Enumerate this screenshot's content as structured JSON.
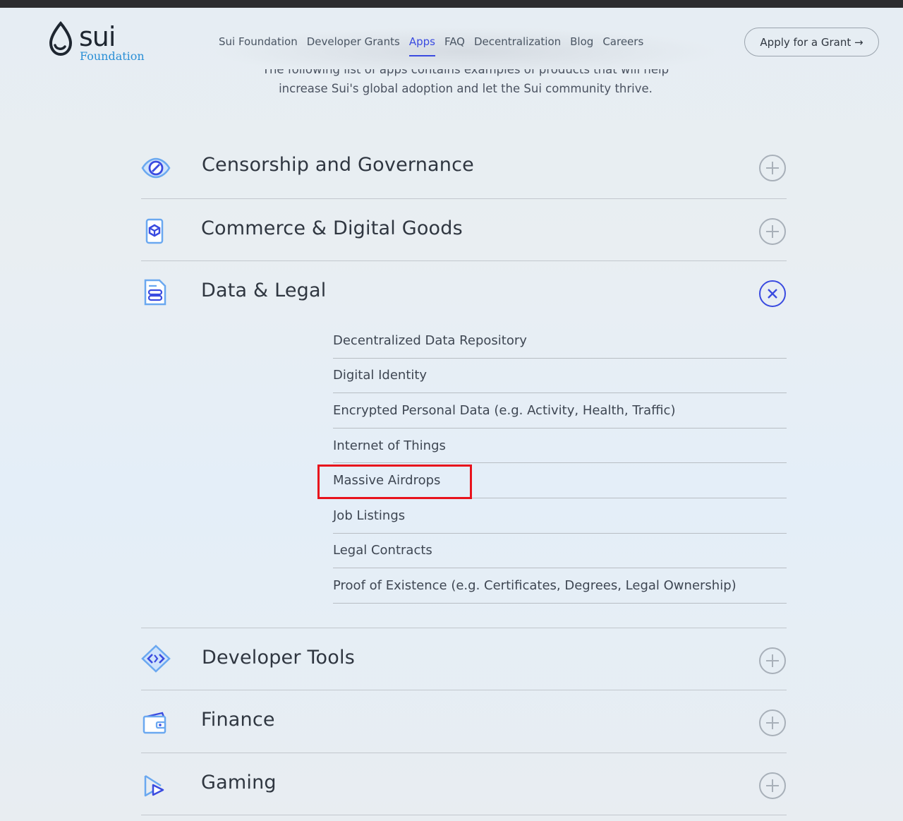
{
  "brand": {
    "name": "sui",
    "subtitle": "Foundation"
  },
  "nav": {
    "items": [
      {
        "label": "Sui Foundation"
      },
      {
        "label": "Developer Grants"
      },
      {
        "label": "Apps",
        "active": true
      },
      {
        "label": "FAQ"
      },
      {
        "label": "Decentralization"
      },
      {
        "label": "Blog"
      },
      {
        "label": "Careers"
      }
    ],
    "cta_label": "Apply for a Grant →"
  },
  "intro": {
    "line1": "The following list of apps contains examples of products that will help",
    "line2": "increase Sui's global adoption and let the Sui community thrive."
  },
  "categories": [
    {
      "title": "Censorship and Governance",
      "icon": "eye-icon",
      "expanded": false
    },
    {
      "title": "Commerce & Digital Goods",
      "icon": "cube-phone-icon",
      "expanded": false
    },
    {
      "title": "Data & Legal",
      "icon": "document-data-icon",
      "expanded": true,
      "items": [
        "Decentralized Data Repository",
        "Digital Identity",
        "Encrypted Personal Data (e.g. Activity, Health, Traffic)",
        "Internet of Things",
        "Massive Airdrops",
        "Job Listings",
        "Legal Contracts",
        "Proof of Existence (e.g. Certificates, Degrees, Legal Ownership)"
      ],
      "highlighted_item": "Massive Airdrops"
    },
    {
      "title": "Developer Tools",
      "icon": "code-diamond-icon",
      "expanded": false
    },
    {
      "title": "Finance",
      "icon": "wallet-icon",
      "expanded": false
    },
    {
      "title": "Gaming",
      "icon": "play-icon",
      "expanded": false
    }
  ],
  "colors": {
    "accent": "#3a4be0",
    "icon_light": "#6aa8f0",
    "highlight": "#e8121c"
  }
}
